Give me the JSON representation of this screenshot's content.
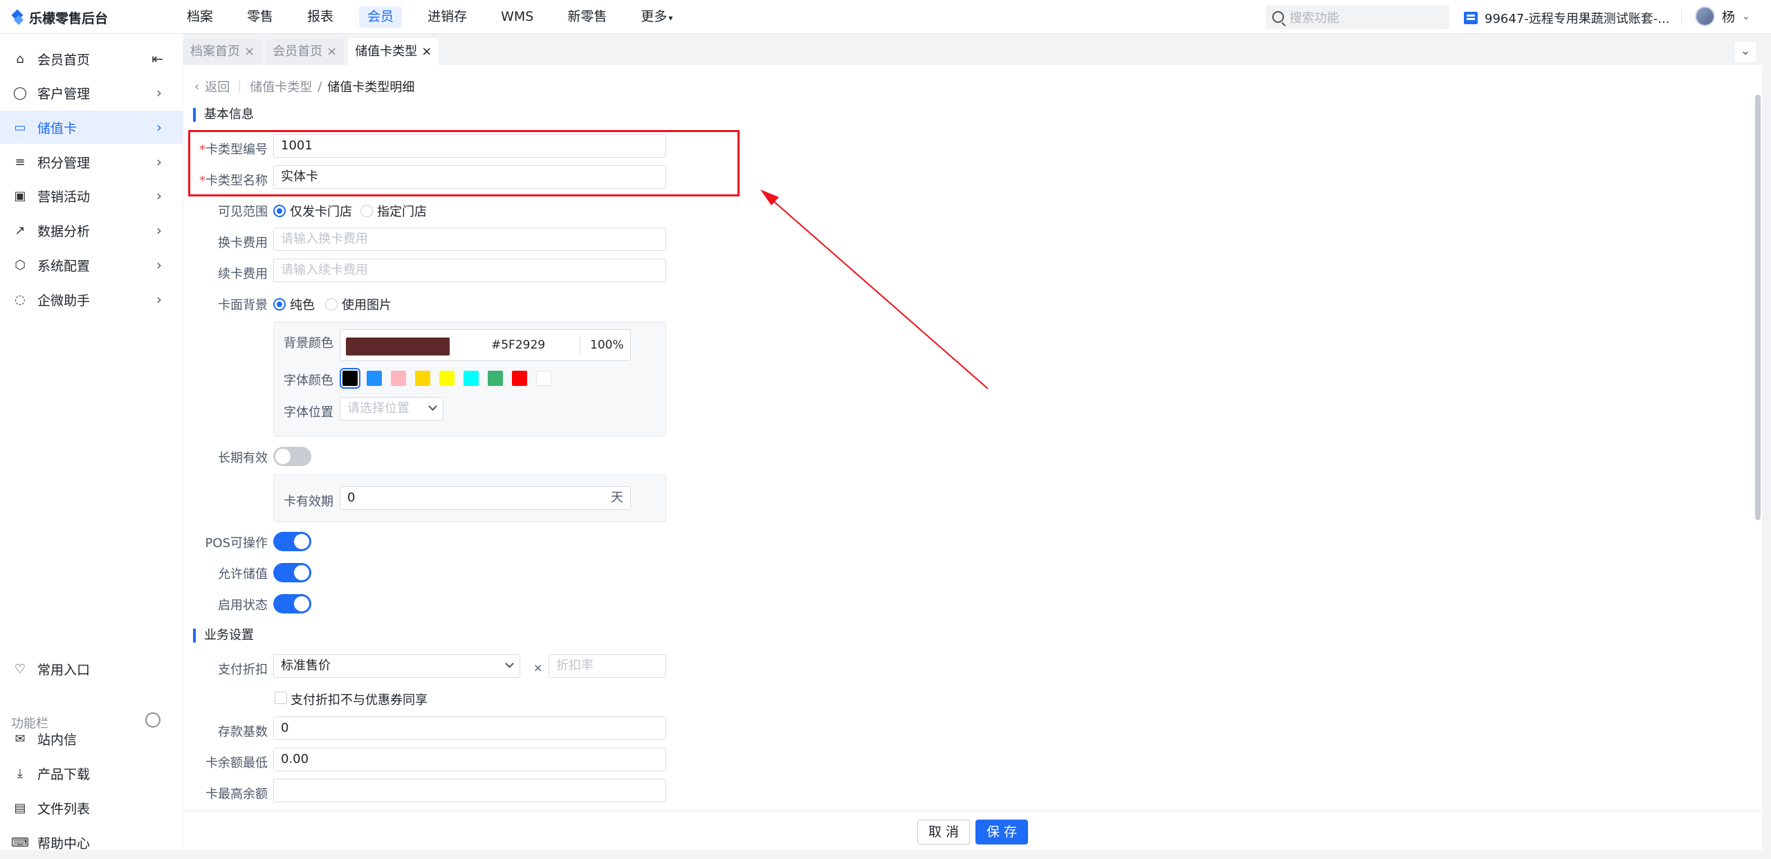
{
  "app": {
    "title": "乐檬零售后台"
  },
  "topnav": {
    "items": [
      "档案",
      "零售",
      "报表",
      "会员",
      "进销存",
      "WMS",
      "新零售",
      "更多"
    ],
    "active_index": 3
  },
  "search": {
    "placeholder": "搜索功能"
  },
  "account": {
    "name": "99647-远程专用果蔬测试账套-..."
  },
  "user": {
    "name": "杨"
  },
  "sidebar": {
    "items": [
      {
        "label": "会员首页",
        "icon": "home-icon"
      },
      {
        "label": "客户管理",
        "icon": "user-icon"
      },
      {
        "label": "储值卡",
        "icon": "card-icon"
      },
      {
        "label": "积分管理",
        "icon": "database-icon"
      },
      {
        "label": "营销活动",
        "icon": "monitor-icon"
      },
      {
        "label": "数据分析",
        "icon": "chart-icon"
      },
      {
        "label": "系统配置",
        "icon": "settings-icon"
      },
      {
        "label": "企微助手",
        "icon": "chat-icon"
      }
    ],
    "active_index": 2,
    "common": "常用入口",
    "func_label": "功能栏",
    "bottom": [
      {
        "label": "站内信",
        "icon": "mail-icon"
      },
      {
        "label": "产品下载",
        "icon": "download-icon"
      },
      {
        "label": "文件列表",
        "icon": "file-list-icon"
      },
      {
        "label": "帮助中心",
        "icon": "help-icon"
      }
    ]
  },
  "tabs": [
    {
      "label": "档案首页",
      "close": "×"
    },
    {
      "label": "会员首页",
      "close": "×"
    },
    {
      "label": "储值卡类型",
      "close": "×"
    }
  ],
  "breadcrumb": {
    "back": "返回",
    "parent": "储值卡类型",
    "sep": "/",
    "current": "储值卡类型明细"
  },
  "basic": {
    "title": "基本信息",
    "code_label": "卡类型编号",
    "code_value": "1001",
    "name_label": "卡类型名称",
    "name_value": "实体卡",
    "required_mark": "*",
    "scope_label": "可见范围",
    "scope_opt1": "仅发卡门店",
    "scope_opt2": "指定门店",
    "change_fee_label": "换卡费用",
    "change_fee_ph": "请输入换卡费用",
    "renew_fee_label": "续卡费用",
    "renew_fee_ph": "请输入续卡费用",
    "bg_label": "卡面背景",
    "bg_opt1": "纯色",
    "bg_opt2": "使用图片",
    "bg_color_label": "背景颜色",
    "bg_color_hex": "#5F2929",
    "bg_opacity": "100%",
    "font_color_label": "字体颜色",
    "font_colors": [
      "#000000",
      "#1e90ff",
      "#ffb6c1",
      "#ffd700",
      "#ffff00",
      "#00ffff",
      "#3cb371",
      "#ff0000",
      "#ffffff"
    ],
    "font_pos_label": "字体位置",
    "font_pos_ph": "请选择位置",
    "long_valid_label": "长期有效",
    "long_valid": false,
    "valid_period_label": "卡有效期",
    "valid_period_value": "0",
    "valid_period_unit": "天",
    "pos_label": "POS可操作",
    "pos_on": true,
    "allow_label": "允许储值",
    "allow_on": true,
    "enable_label": "启用状态",
    "enable_on": true
  },
  "business": {
    "title": "业务设置",
    "discount_label": "支付折扣",
    "discount_value": "标准售价",
    "times": "×",
    "rate_ph": "折扣率",
    "no_coupon_label": "支付折扣不与优惠券同享",
    "deposit_label": "存款基数",
    "deposit_value": "0",
    "min_label": "卡余额最低",
    "min_value": "0.00",
    "max_label": "卡最高余额",
    "max_value": ""
  },
  "footer": {
    "cancel": "取 消",
    "save": "保 存"
  }
}
